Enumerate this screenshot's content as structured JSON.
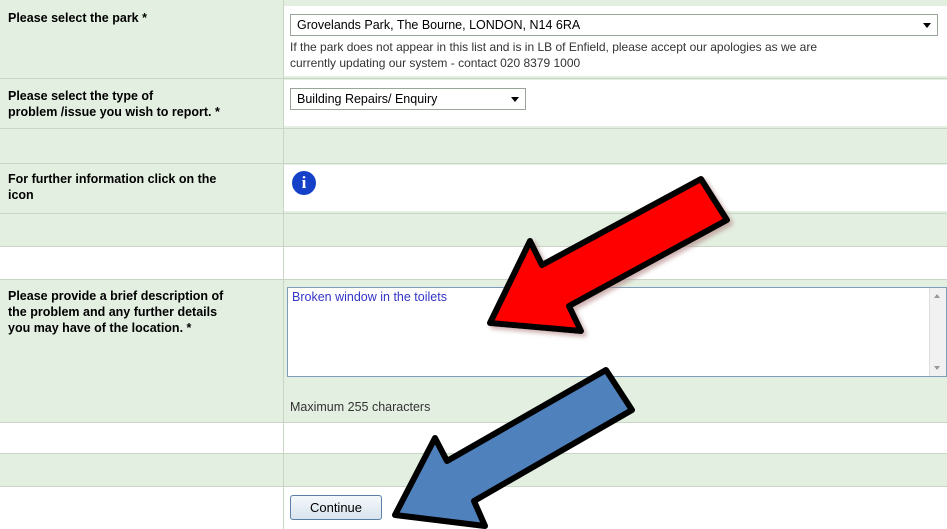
{
  "park": {
    "label": "Please select the park *",
    "selected": "Grovelands Park, The Bourne, LONDON, N14 6RA",
    "note_line1": "If the park does not appear in this list and is in LB of Enfield, please accept our apologies as we are",
    "note_line2": "currently updating our system - contact 020 8379 1000"
  },
  "problem": {
    "label_line1": "Please select the type of",
    "label_line2": "problem /issue you wish to report. *",
    "selected": "Building Repairs/ Enquiry"
  },
  "info": {
    "label_line1": "For further information click on the",
    "label_line2": "icon",
    "icon_glyph": "i"
  },
  "description": {
    "label_line1": "Please provide a brief description of",
    "label_line2": "the problem and any further details",
    "label_line3": "you may have of the location. *",
    "value": "Broken window in the toilets",
    "max_note": "Maximum 255 characters"
  },
  "continue_button": "Continue",
  "colors": {
    "row_green": "#e3efe1",
    "red_arrow": "#ff0000",
    "blue_arrow": "#4f81bd",
    "info_icon": "#1540c8"
  }
}
